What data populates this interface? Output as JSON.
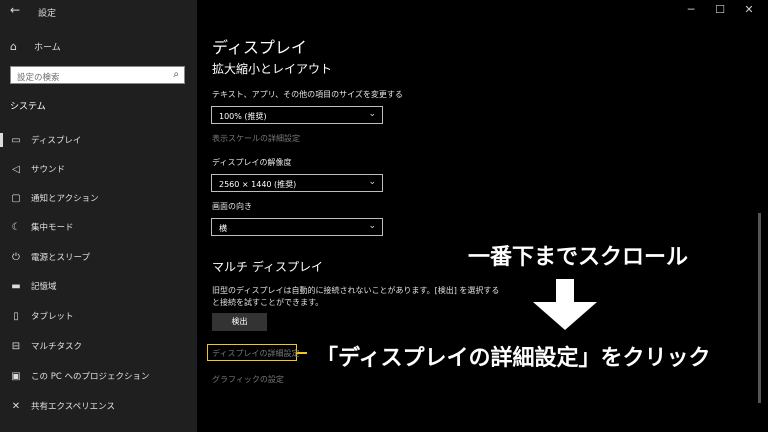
{
  "titlebar": {
    "back_icon": "back-arrow-icon",
    "title": "設定",
    "controls": [
      "minimize-icon",
      "maximize-icon",
      "close-icon"
    ]
  },
  "sidebar": {
    "home_label": "ホーム",
    "search_placeholder": "設定の検索",
    "section_label": "システム",
    "items": [
      {
        "label": "ディスプレイ",
        "icon": "display-icon",
        "active": true
      },
      {
        "label": "サウンド",
        "icon": "speaker-icon"
      },
      {
        "label": "通知とアクション",
        "icon": "notification-icon"
      },
      {
        "label": "集中モード",
        "icon": "moon-icon"
      },
      {
        "label": "電源とスリープ",
        "icon": "power-icon"
      },
      {
        "label": "記憶域",
        "icon": "storage-icon"
      },
      {
        "label": "タブレット",
        "icon": "tablet-icon"
      },
      {
        "label": "マルチタスク",
        "icon": "multitask-icon"
      },
      {
        "label": "この PC へのプロジェクション",
        "icon": "projection-icon"
      },
      {
        "label": "共有エクスペリエンス",
        "icon": "shared-experience-icon"
      }
    ]
  },
  "main": {
    "title": "ディスプレイ",
    "scale_heading": "拡大縮小とレイアウト",
    "scale_label": "テキスト、アプリ、その他の項目のサイズを変更する",
    "scale_value": "100% (推奨)",
    "advanced_scale_link": "表示スケールの詳細設定",
    "resolution_label": "ディスプレイの解像度",
    "resolution_value": "2560 × 1440 (推奨)",
    "orientation_label": "画面の向き",
    "orientation_value": "横",
    "multi_heading": "マルチ ディスプレイ",
    "multi_text": "旧型のディスプレイは自動的に接続されないことがあります。[検出] を選択すると接続を試すことができます。",
    "detect_button": "検出",
    "advanced_display_link": "ディスプレイの詳細設定",
    "graphics_link": "グラフィックの設定"
  },
  "annotations": {
    "scroll_text": "一番下までスクロール",
    "click_text": "「ディスプレイの詳細設定」をクリック",
    "highlight_color": "#f5c518"
  }
}
